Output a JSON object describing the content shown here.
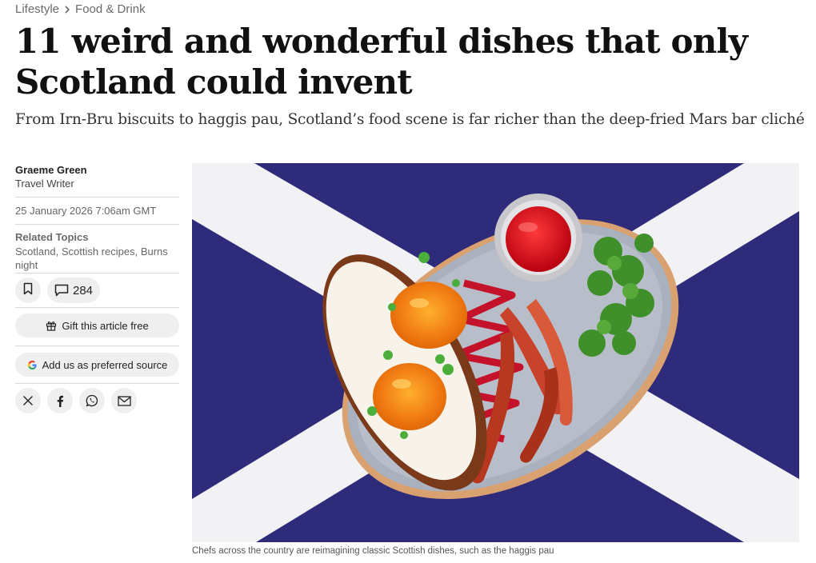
{
  "breadcrumb": {
    "section": "Lifestyle",
    "subsection": "Food & Drink"
  },
  "article": {
    "headline_line1": "11 weird and wonderful dishes that only",
    "headline_line2": "Scotland could invent",
    "standfirst": "From Irn-Bru biscuits to haggis pau, Scotland’s food scene is far richer than the deep-fried Mars bar cliché",
    "image_caption": "Chefs across the country are reimagining classic Scottish dishes, such as the haggis pau"
  },
  "sidebar": {
    "author_name": "Graeme Green",
    "author_role": "Travel Writer",
    "date": "25 January 2026 7:06am GMT",
    "topics_title": "Related Topics",
    "topics": [
      "Scotland",
      "Scottish recipes",
      "Burns night"
    ],
    "comment_count": "284",
    "gift_label": "Gift this article free",
    "preferred_source_label": "Add us as preferred source"
  },
  "icons": {
    "bookmark": "bookmark-icon",
    "comment": "comment-icon",
    "gift": "gift-icon",
    "google": "google-icon",
    "x": "x-icon",
    "facebook": "facebook-icon",
    "whatsapp": "whatsapp-icon",
    "email": "email-icon"
  },
  "colors": {
    "flag_blue": "#2d2b7a",
    "flag_white": "#f2f2f5",
    "button_bg": "#efefef",
    "text_muted": "#6a6a6a"
  }
}
